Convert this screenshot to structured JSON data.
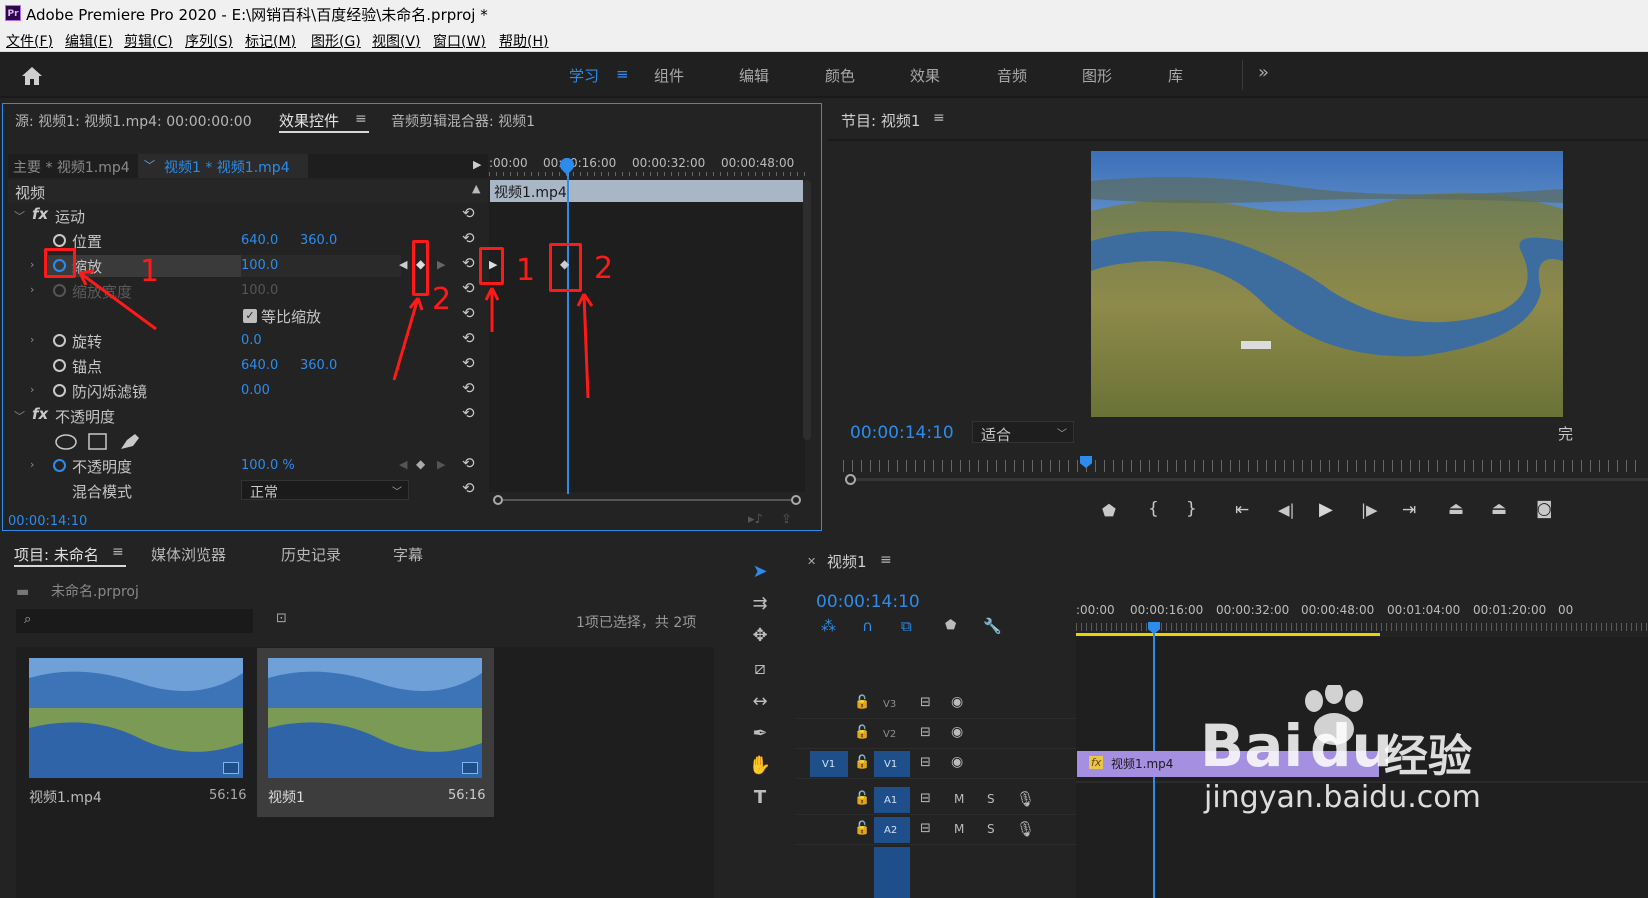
{
  "window": {
    "app_title": "Adobe Premiere Pro 2020 - E:\\网销百科\\百度经验\\未命名.prproj *",
    "logo_text": "Pr"
  },
  "menu": [
    "文件(F)",
    "编辑(E)",
    "剪辑(C)",
    "序列(S)",
    "标记(M)",
    "图形(G)",
    "视图(V)",
    "窗口(W)",
    "帮助(H)"
  ],
  "workspaces": [
    "学习",
    "组件",
    "编辑",
    "颜色",
    "效果",
    "音频",
    "图形",
    "库"
  ],
  "workspace_more": "»",
  "effect_panel": {
    "source_tab": "源: 视频1: 视频1.mp4: 00:00:00:00",
    "active_tab": "效果控件",
    "mixer_tab": "音频剪辑混合器: 视频1",
    "master_clip": "主要 * 视频1.mp4",
    "seq_clip": "视频1 * 视频1.mp4",
    "section_video": "视频",
    "motion": "运动",
    "fx": "fx",
    "props": {
      "position": {
        "label": "位置",
        "x": "640.0",
        "y": "360.0"
      },
      "scale": {
        "label": "缩放",
        "value": "100.0"
      },
      "scale_width": {
        "label": "缩放宽度",
        "value": "100.0"
      },
      "uniform": {
        "label": "等比缩放"
      },
      "rotation": {
        "label": "旋转",
        "value": "0.0"
      },
      "anchor": {
        "label": "锚点",
        "x": "640.0",
        "y": "360.0"
      },
      "flicker": {
        "label": "防闪烁滤镜",
        "value": "0.00"
      }
    },
    "opacity_section": "不透明度",
    "opacity": {
      "label": "不透明度",
      "value": "100.0 %"
    },
    "blend": {
      "label": "混合模式",
      "value": "正常"
    },
    "timecode": "00:00:14:10",
    "ruler": [
      ":00:00",
      "00:00:16:00",
      "00:00:32:00",
      "00:00:48:00"
    ],
    "clip_name": "视频1.mp4"
  },
  "annotations": {
    "one": "1",
    "two": "2"
  },
  "program": {
    "title": "节目: 视频1",
    "timecode": "00:00:14:10",
    "fit": "适合",
    "cut_label": "完"
  },
  "project": {
    "tabs": [
      "项目: 未命名",
      "媒体浏览器",
      "历史记录",
      "字幕"
    ],
    "file": "未命名.prproj",
    "selection": "1项已选择，共 2项",
    "items": [
      {
        "name": "视频1.mp4",
        "duration": "56:16"
      },
      {
        "name": "视频1",
        "duration": "56:16"
      }
    ]
  },
  "timeline": {
    "title": "视频1",
    "timecode": "00:00:14:10",
    "ruler": [
      ":00:00",
      "00:00:16:00",
      "00:00:32:00",
      "00:00:48:00",
      "00:01:04:00",
      "00:01:20:00",
      "00"
    ],
    "tracks": [
      "V3",
      "V2",
      "V1",
      "A1",
      "A2"
    ],
    "source_patch": "V1",
    "clip": {
      "fx": "fx",
      "name": "视频1.mp4"
    },
    "m": "M",
    "s": "S"
  },
  "watermark": {
    "brand": "Bai",
    "brand_mid": "du",
    "cn": "经验",
    "url": "jingyan.baidu.com"
  },
  "colors": {
    "accent": "#2d8ceb",
    "annotation": "#ff1a1a",
    "clip": "#a58fe0",
    "work_area": "#e8d400"
  }
}
